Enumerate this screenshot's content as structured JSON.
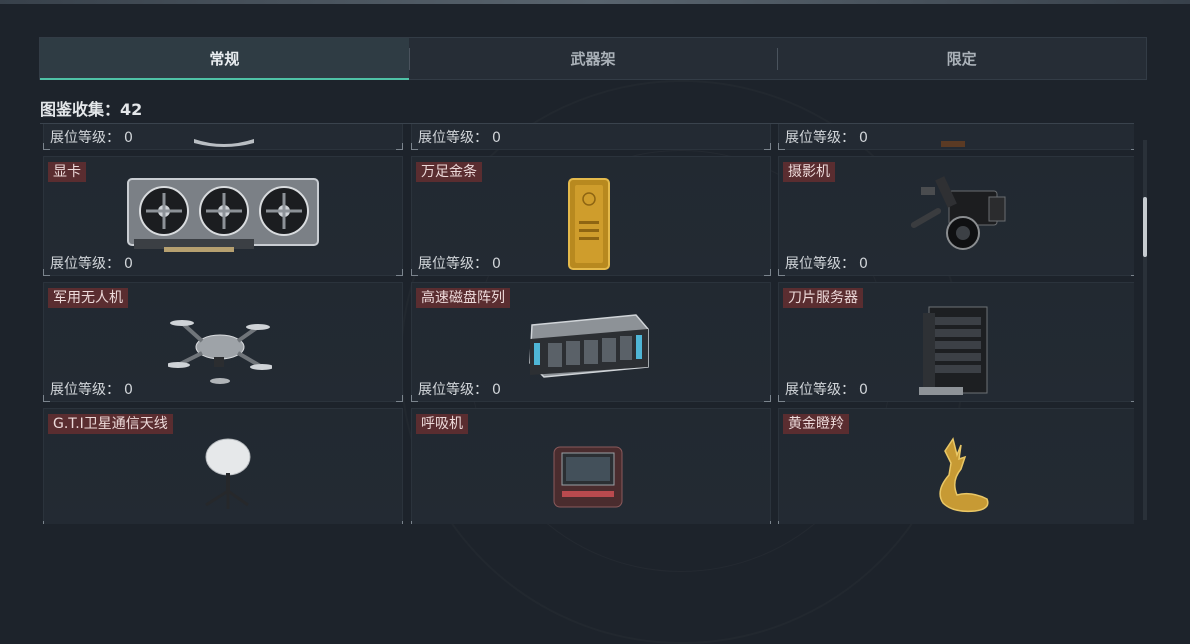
{
  "tabs": [
    {
      "label": "常规",
      "active": true
    },
    {
      "label": "武器架",
      "active": false
    },
    {
      "label": "限定",
      "active": false
    }
  ],
  "collection": {
    "label": "图鉴收集：",
    "count": "42"
  },
  "level_label": "展位等级：",
  "rows": [
    [
      {
        "name": "",
        "level": "0",
        "icon": "partial-item-icon"
      },
      {
        "name": "",
        "level": "0",
        "icon": "partial-item-icon"
      },
      {
        "name": "",
        "level": "0",
        "icon": "partial-item-icon"
      }
    ],
    [
      {
        "name": "显卡",
        "level": "0",
        "icon": "graphics-card-icon"
      },
      {
        "name": "万足金条",
        "level": "0",
        "icon": "gold-bar-icon"
      },
      {
        "name": "摄影机",
        "level": "0",
        "icon": "camera-icon"
      }
    ],
    [
      {
        "name": "军用无人机",
        "level": "0",
        "icon": "drone-icon"
      },
      {
        "name": "高速磁盘阵列",
        "level": "0",
        "icon": "disk-array-icon"
      },
      {
        "name": "刀片服务器",
        "level": "0",
        "icon": "blade-server-icon"
      }
    ],
    [
      {
        "name": "G.T.I卫星通信天线",
        "level": "",
        "icon": "satellite-dish-icon"
      },
      {
        "name": "呼吸机",
        "level": "",
        "icon": "ventilator-icon"
      },
      {
        "name": "黄金瞪羚",
        "level": "",
        "icon": "golden-gazelle-icon"
      }
    ]
  ],
  "colors": {
    "accent": "#4fc2a6",
    "name_tag_bg": "#5a2d30",
    "background": "#1d232b"
  }
}
